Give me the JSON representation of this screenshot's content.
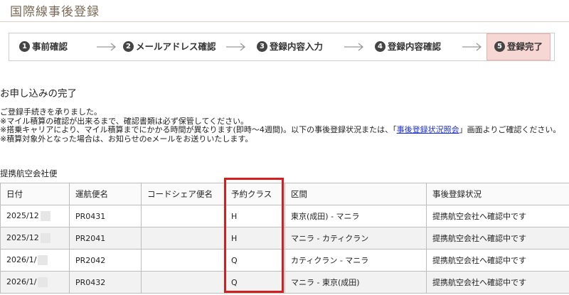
{
  "page": {
    "title": "国際線事後登録"
  },
  "steps": [
    {
      "num": "1",
      "label": "事前確認",
      "active": false
    },
    {
      "num": "2",
      "label": "メールアドレス確認",
      "active": false
    },
    {
      "num": "3",
      "label": "登録内容入力",
      "active": false
    },
    {
      "num": "4",
      "label": "登録内容確認",
      "active": false
    },
    {
      "num": "5",
      "label": "登録完了",
      "active": true
    }
  ],
  "colors": {
    "active_step_bg": "#f6d7d3",
    "link": "#1a2fd1",
    "highlight_border": "#d21f1f"
  },
  "main": {
    "heading": "お申し込みの完了",
    "notes": {
      "line1": "ご登録手続きを承りました。",
      "line2": "※マイル積算の確認が出来るまで、確認書類は必ず保管してください。",
      "line3_before": "※搭乗キャリアにより、マイル積算までにかかる時間が異なります(即時～4週間)。以下の事後登録状況または、「",
      "line3_link": "事後登録状況照会",
      "line3_after": "」画面よりご確認ください。",
      "line4": "※積算対象外となった場合は、お知らせのeメールをお送りいたします。"
    },
    "table_caption": "提携航空会社便",
    "table": {
      "headers": [
        "日付",
        "運航便名",
        "コードシェア便名",
        "予約クラス",
        "区間",
        "事後登録状況"
      ],
      "rows": [
        {
          "date": "2025/12",
          "flight": "PR0431",
          "codeshare": "",
          "class": "H",
          "route": "東京(成田) - マニラ",
          "status": "提携航空会社へ確認中です"
        },
        {
          "date": "2025/12",
          "flight": "PR2041",
          "codeshare": "",
          "class": "H",
          "route": "マニラ - カティクラン",
          "status": "提携航空会社へ確認中です"
        },
        {
          "date": "2026/1/",
          "flight": "PR2042",
          "codeshare": "",
          "class": "Q",
          "route": "カティクラン - マニラ",
          "status": "提携航空会社へ確認中です"
        },
        {
          "date": "2026/1/",
          "flight": "PR0432",
          "codeshare": "",
          "class": "Q",
          "route": "マニラ - 東京(成田)",
          "status": "提携航空会社へ確認中です"
        }
      ]
    }
  }
}
